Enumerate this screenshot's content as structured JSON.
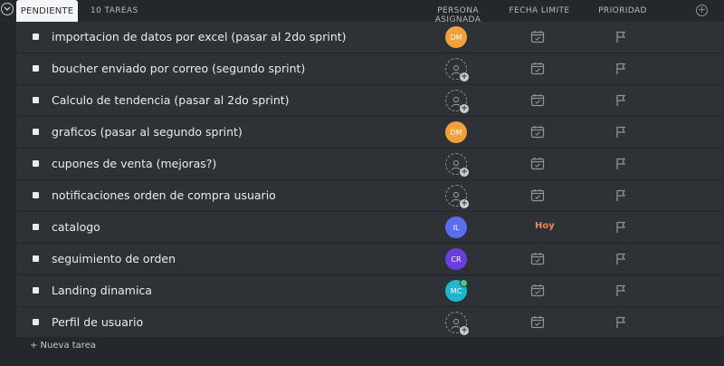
{
  "header": {
    "status_label": "PENDIENTE",
    "task_count": "10 TAREAS",
    "col_assignee": "PERSONA ASIGNADA",
    "col_due": "FECHA LIMITE",
    "col_priority": "PRIORIDAD",
    "add_column_icon": "plus-circle-icon"
  },
  "tasks": [
    {
      "name": "importacion de datos por excel (pasar al 2do sprint)",
      "assignee": "DM",
      "assignee_color": "#f3a03a",
      "due": ""
    },
    {
      "name": "boucher enviado por correo (segundo sprint)",
      "assignee": "",
      "due": ""
    },
    {
      "name": "Calculo de tendencia (pasar al 2do sprint)",
      "assignee": "",
      "due": ""
    },
    {
      "name": "graficos (pasar al segundo sprint)",
      "assignee": "DM",
      "assignee_color": "#f3a03a",
      "due": ""
    },
    {
      "name": "cupones de venta (mejoras?)",
      "assignee": "",
      "due": ""
    },
    {
      "name": "notificaciones orden de compra usuario",
      "assignee": "",
      "due": ""
    },
    {
      "name": "catalogo",
      "assignee": "IL",
      "assignee_color": "#5b6cf0",
      "due": "Hoy"
    },
    {
      "name": "seguimiento de orden",
      "assignee": "CR",
      "assignee_color": "#6a3ee0",
      "due": ""
    },
    {
      "name": "Landing dinamica",
      "assignee": "MC",
      "assignee_color": "#1fb6cf",
      "due": "",
      "online": true
    },
    {
      "name": "Perfil de usuario",
      "assignee": "",
      "due": ""
    }
  ],
  "footer": {
    "new_task_label": "+ Nueva tarea"
  },
  "colors": {
    "background": "#24272b",
    "row": "#2e3237",
    "due_today": "#f0894e"
  }
}
